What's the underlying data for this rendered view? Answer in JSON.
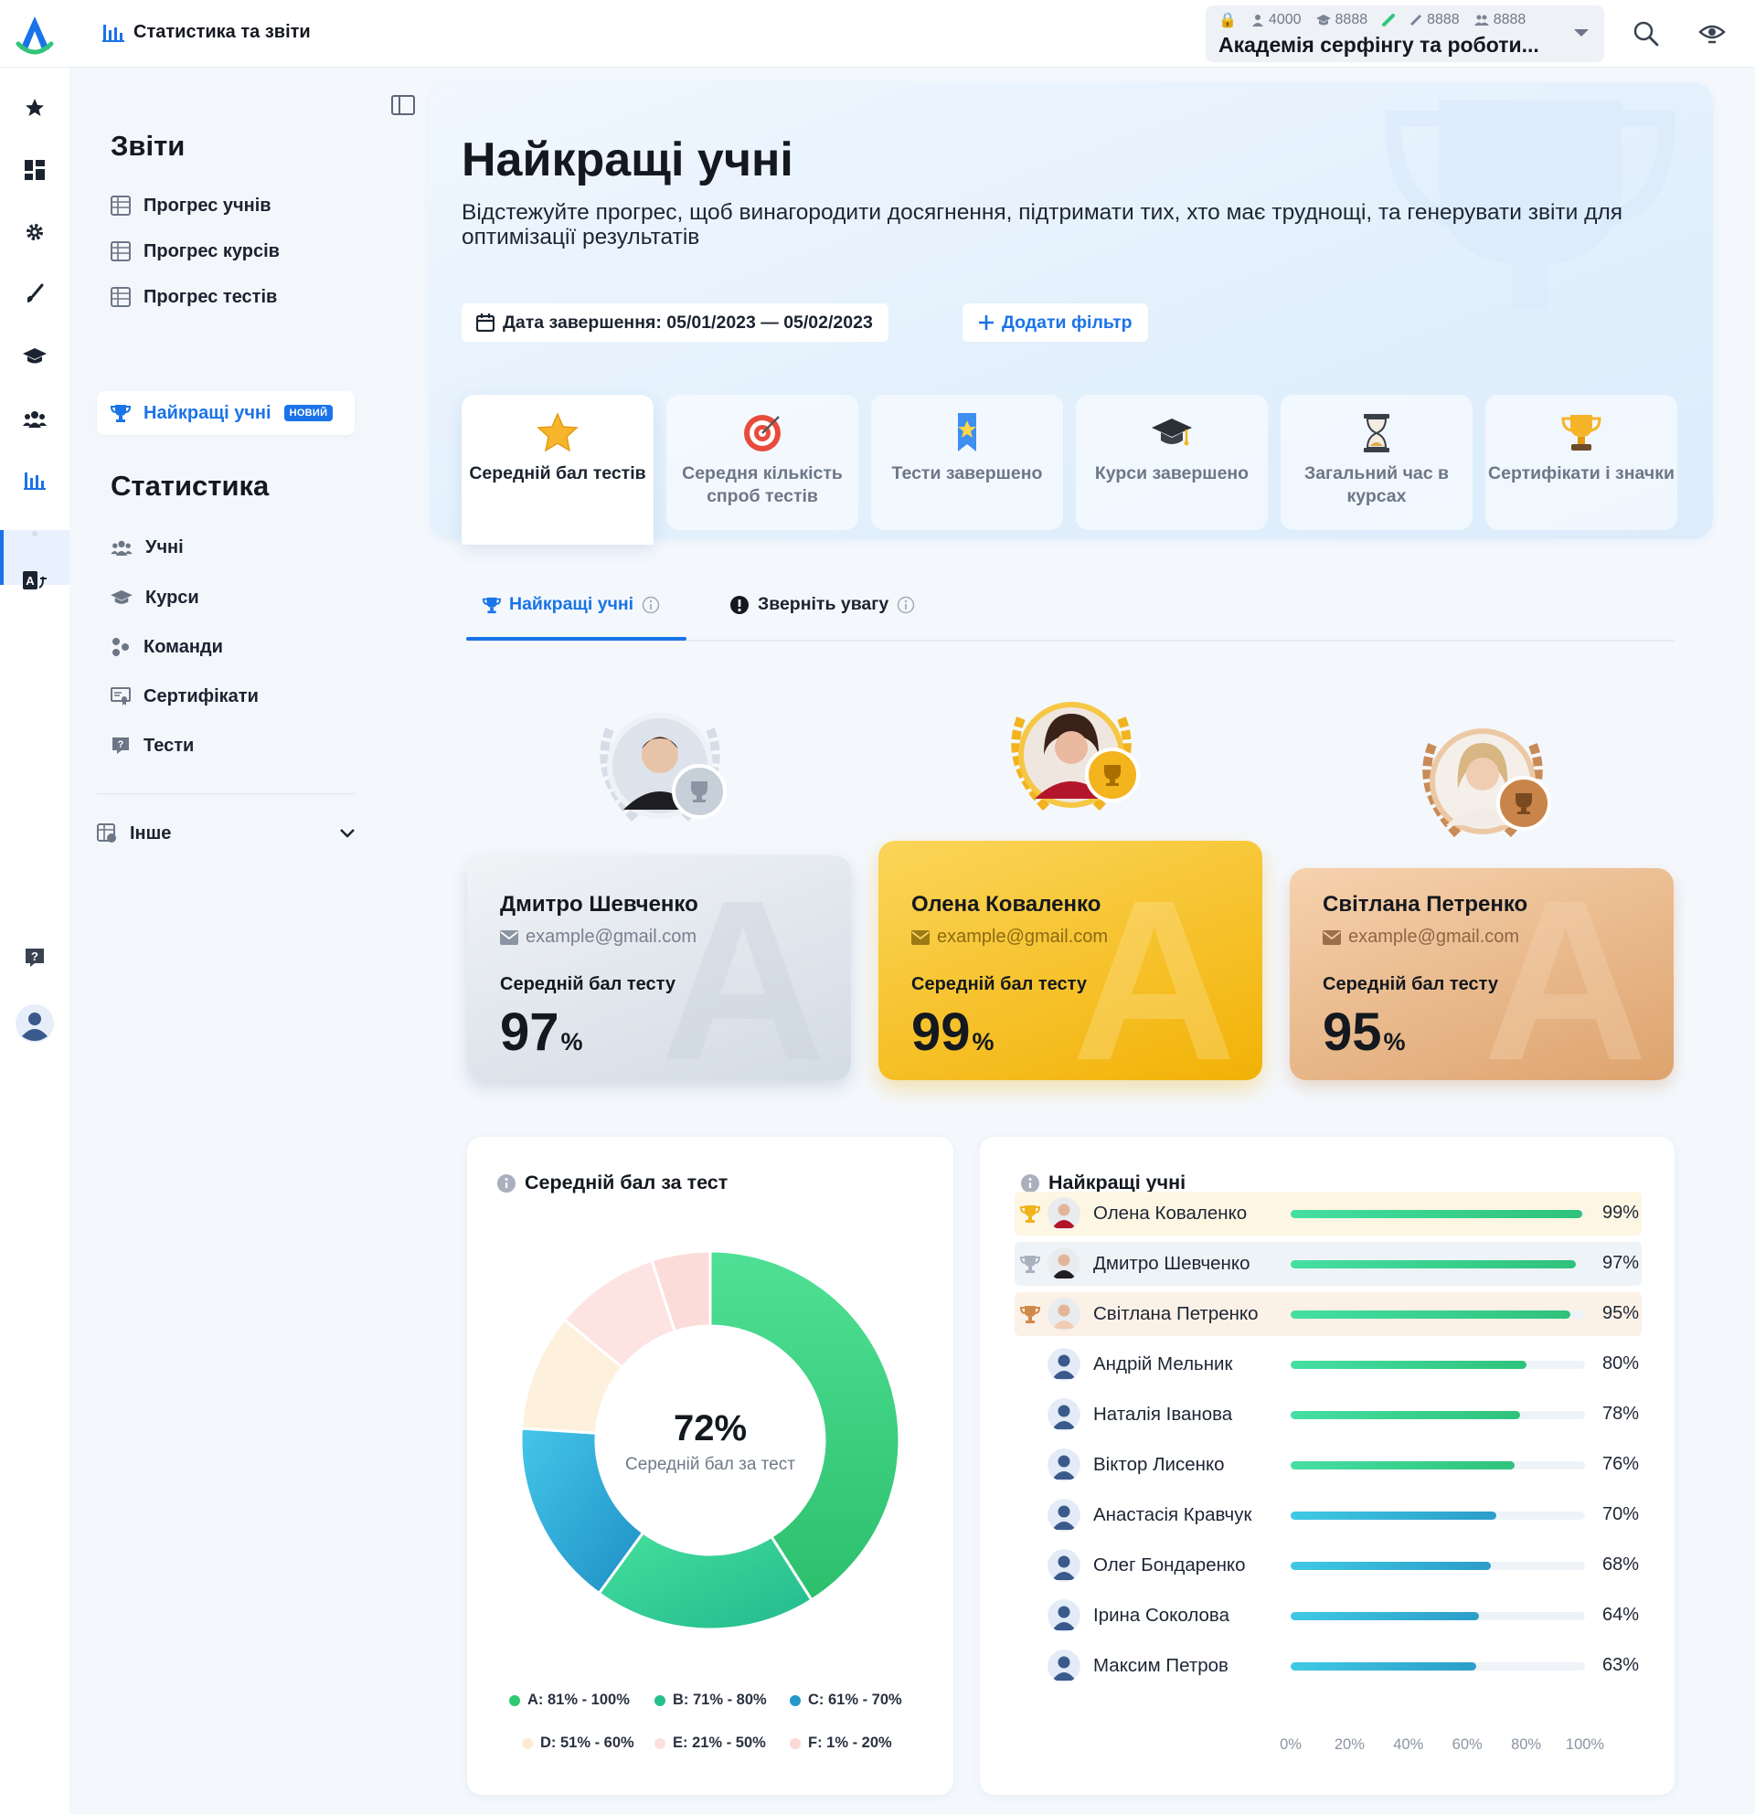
{
  "topbar": {
    "breadcrumb": "Статистика та звіти",
    "org": {
      "stats": [
        "4000",
        "8888",
        "8888",
        "8888"
      ],
      "name": "Академія серфінгу та роботи..."
    }
  },
  "sidebar": {
    "reports_heading": "Звіти",
    "reports": [
      {
        "label": "Прогрес учнів",
        "icon": "table-icon"
      },
      {
        "label": "Прогрес курсів",
        "icon": "table-icon"
      },
      {
        "label": "Прогрес тестів",
        "icon": "table-icon"
      },
      {
        "label": "Найкращі учні",
        "icon": "trophy-icon",
        "badge": "НОВИЙ"
      }
    ],
    "stats_heading": "Статистика",
    "stats": [
      {
        "label": "Учні",
        "icon": "users-icon"
      },
      {
        "label": "Курси",
        "icon": "graduation-cap-icon"
      },
      {
        "label": "Команди",
        "icon": "teams-icon"
      },
      {
        "label": "Сертифікати",
        "icon": "certificate-icon"
      },
      {
        "label": "Тести",
        "icon": "quiz-icon"
      }
    ],
    "other_label": "Інше"
  },
  "hero": {
    "title": "Найкращі учні",
    "subtitle": "Відстежуйте прогрес, щоб винагородити досягнення, підтримати тих, хто має труднощі, та генерувати звіти для оптимізації результатів",
    "date_filter": "Дата завершення: 05/01/2023 — 05/02/2023",
    "add_filter": "Додати фільтр"
  },
  "metric_tabs": [
    {
      "label": "Середній бал тестів",
      "icon": "star-icon",
      "active": true
    },
    {
      "label": "Середня кількість спроб тестів",
      "icon": "target-icon",
      "active": false
    },
    {
      "label": "Тести завершено",
      "icon": "ribbon-icon",
      "active": false
    },
    {
      "label": "Курси завершено",
      "icon": "graduation-cap-icon",
      "active": false
    },
    {
      "label": "Загальний час в курсах",
      "icon": "hourglass-icon",
      "active": false
    },
    {
      "label": "Сертифікати і значки",
      "icon": "trophy-icon",
      "active": false
    }
  ],
  "sub_tabs": [
    {
      "label": "Найкращі учні",
      "active": true
    },
    {
      "label": "Зверніть увагу",
      "active": false
    }
  ],
  "podium": [
    {
      "place": 2,
      "name": "Дмитро Шевченко",
      "email": "example@gmail.com",
      "label": "Середній бал тесту",
      "value": "97",
      "unit": "%"
    },
    {
      "place": 1,
      "name": "Олена Коваленко",
      "email": "example@gmail.com",
      "label": "Середній бал тесту",
      "value": "99",
      "unit": "%"
    },
    {
      "place": 3,
      "name": "Світлана Петренко",
      "email": "example@gmail.com",
      "label": "Середній бал тесту",
      "value": "95",
      "unit": "%"
    }
  ],
  "donut": {
    "title": "Середній бал за тест",
    "center_value": "72%",
    "center_label": "Середній бал за тест"
  },
  "leaderboard": {
    "title": "Найкращі учні",
    "ticks": [
      "0%",
      "20%",
      "40%",
      "60%",
      "80%",
      "100%"
    ]
  },
  "chart_data": [
    {
      "type": "pie",
      "title": "Середній бал за тест",
      "center_label": "72%",
      "slices": [
        {
          "label": "A: 81% - 100%",
          "value": 41,
          "color": "#3ed07f"
        },
        {
          "label": "B: 71% - 80%",
          "value": 19,
          "color": "#2ec99a"
        },
        {
          "label": "C: 61% - 70%",
          "value": 16,
          "color": "#2aa6d4"
        },
        {
          "label": "D: 51% - 60%",
          "value": 10,
          "color": "#fdebd0"
        },
        {
          "label": "E: 21% - 50%",
          "value": 9,
          "color": "#fde0df"
        },
        {
          "label": "F: 1% - 20%",
          "value": 5,
          "color": "#fcd9d6"
        }
      ]
    },
    {
      "type": "bar",
      "title": "Найкращі учні",
      "orientation": "horizontal",
      "xlim": [
        0,
        100
      ],
      "categories": [
        "Олена Коваленко",
        "Дмитро Шевченко",
        "Світлана Петренко",
        "Андрій Мельник",
        "Наталія Іванова",
        "Віктор Лисенко",
        "Анастасія Кравчук",
        "Олег Бондаренко",
        "Ірина Соколова",
        "Максим Петров"
      ],
      "values": [
        99,
        97,
        95,
        80,
        78,
        76,
        70,
        68,
        64,
        63
      ],
      "labels": [
        "99%",
        "97%",
        "95%",
        "80%",
        "78%",
        "76%",
        "70%",
        "68%",
        "64%",
        "63%"
      ],
      "medals": [
        "gold",
        "silver",
        "bronze",
        "",
        "",
        "",
        "",
        "",
        "",
        ""
      ]
    }
  ]
}
